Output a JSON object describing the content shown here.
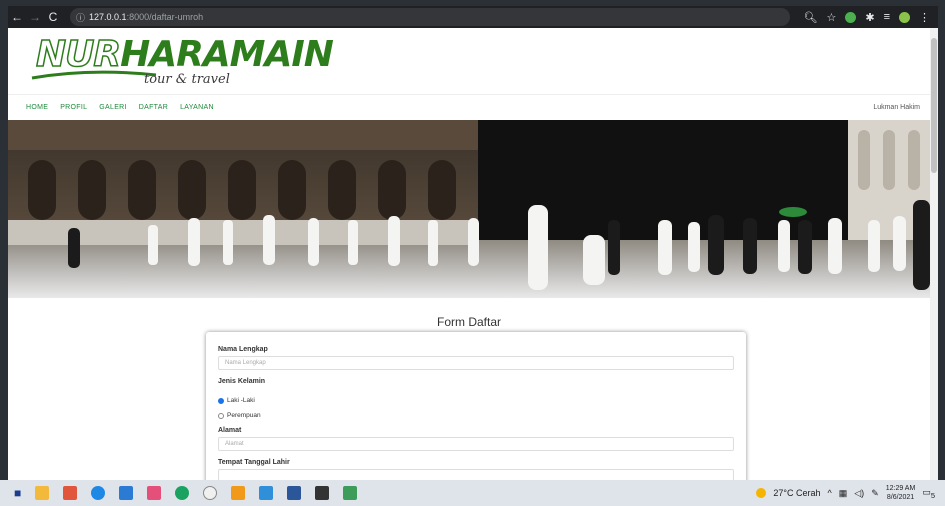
{
  "browser": {
    "url_host": "127.0.0.1",
    "url_path": ":8000/daftar-umroh"
  },
  "site": {
    "logo_main": "NURHARAMAIN",
    "logo_nur": "NUR",
    "logo_rest": "HARAMAIN",
    "logo_sub": "tour & travel",
    "nav": [
      "HOME",
      "PROFIL",
      "GALERI",
      "DAFTAR",
      "LAYANAN"
    ],
    "user": "Lukman Hakim"
  },
  "form": {
    "title": "Form Daftar",
    "nama_label": "Nama Lengkap",
    "nama_placeholder": "Nama Lengkap",
    "jk_label": "Jenis Kelamin",
    "jk_options": [
      "Laki -Laki",
      "Perempuan"
    ],
    "jk_selected": "Laki -Laki",
    "alamat_label": "Alamat",
    "alamat_placeholder": "Alamat",
    "ttl_label": "Tempat Tanggal Lahir"
  },
  "taskbar": {
    "weather": "27°C Cerah",
    "time": "12:29 AM",
    "date": "8/6/2021",
    "notification_count": "5"
  },
  "colors": {
    "brand_green": "#2e7d1c",
    "nav_green": "#1e8a3a"
  }
}
